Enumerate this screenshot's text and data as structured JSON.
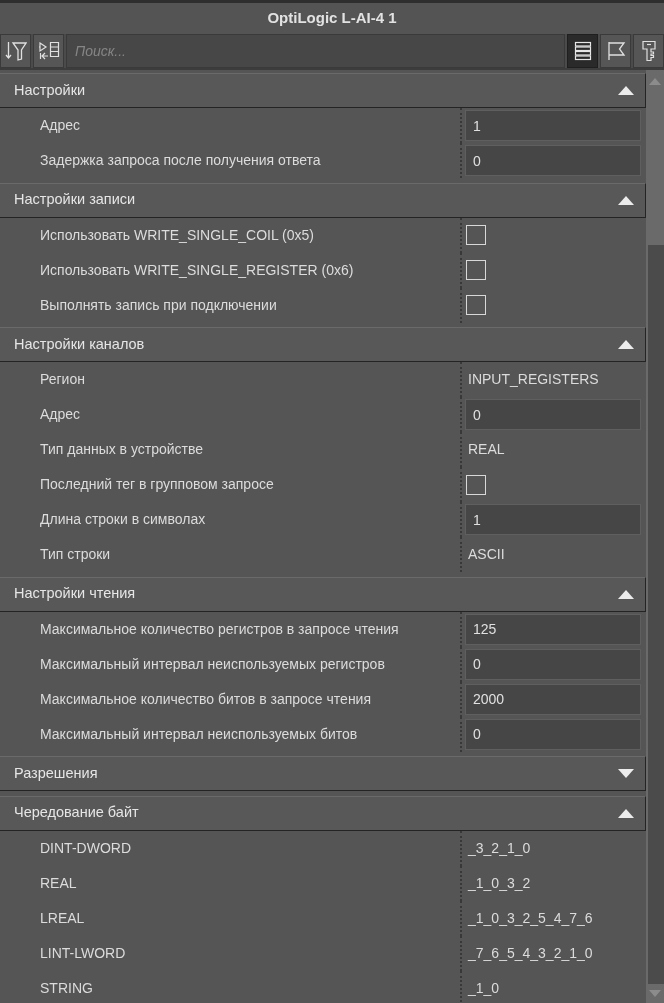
{
  "window": {
    "title": "OptiLogic L-AI-4 1"
  },
  "toolbar": {
    "search": {
      "placeholder": "Поиск..."
    },
    "view_buttons": [
      {
        "selected": true
      },
      {
        "selected": false
      },
      {
        "selected": false
      }
    ]
  },
  "sections": [
    {
      "title": "Настройки",
      "expanded": true,
      "rows": [
        {
          "kind": "input",
          "label": "Адрес",
          "value": "1"
        },
        {
          "kind": "input",
          "label": "Задержка запроса после получения ответа",
          "value": "0"
        }
      ]
    },
    {
      "title": "Настройки записи",
      "expanded": true,
      "rows": [
        {
          "kind": "checkbox",
          "label": "Использовать WRITE_SINGLE_COIL (0x5)",
          "checked": false
        },
        {
          "kind": "checkbox",
          "label": "Использовать WRITE_SINGLE_REGISTER (0x6)",
          "checked": false
        },
        {
          "kind": "checkbox",
          "label": "Выполнять запись при подключении",
          "checked": false
        }
      ]
    },
    {
      "title": "Настройки каналов",
      "expanded": true,
      "rows": [
        {
          "kind": "text",
          "label": "Регион",
          "value": "INPUT_REGISTERS"
        },
        {
          "kind": "input",
          "label": "Адрес",
          "value": "0"
        },
        {
          "kind": "text",
          "label": "Тип данных в устройстве",
          "value": "REAL"
        },
        {
          "kind": "checkbox",
          "label": "Последний тег в групповом запросе",
          "checked": false
        },
        {
          "kind": "input",
          "label": "Длина строки в символах",
          "value": "1"
        },
        {
          "kind": "text",
          "label": "Тип строки",
          "value": "ASCII"
        }
      ]
    },
    {
      "title": "Настройки чтения",
      "expanded": true,
      "rows": [
        {
          "kind": "input",
          "label": "Максимальное количество регистров в запросе чтения",
          "value": "125"
        },
        {
          "kind": "input",
          "label": "Максимальный интервал неиспользуемых регистров",
          "value": "0"
        },
        {
          "kind": "input",
          "label": "Максимальное количество битов в запросе чтения",
          "value": "2000"
        },
        {
          "kind": "input",
          "label": "Максимальный интервал неиспользуемых битов",
          "value": "0"
        }
      ]
    },
    {
      "title": "Разрешения",
      "expanded": false
    },
    {
      "title": "Чередование байт",
      "expanded": true,
      "rows": [
        {
          "kind": "text",
          "label": "DINT-DWORD",
          "value": "_3_2_1_0"
        },
        {
          "kind": "text",
          "label": "REAL",
          "value": "_1_0_3_2"
        },
        {
          "kind": "text",
          "label": "LREAL",
          "value": "_1_0_3_2_5_4_7_6"
        },
        {
          "kind": "text",
          "label": "LINT-LWORD",
          "value": "_7_6_5_4_3_2_1_0"
        },
        {
          "kind": "text",
          "label": "STRING",
          "value": "_1_0"
        }
      ]
    }
  ]
}
